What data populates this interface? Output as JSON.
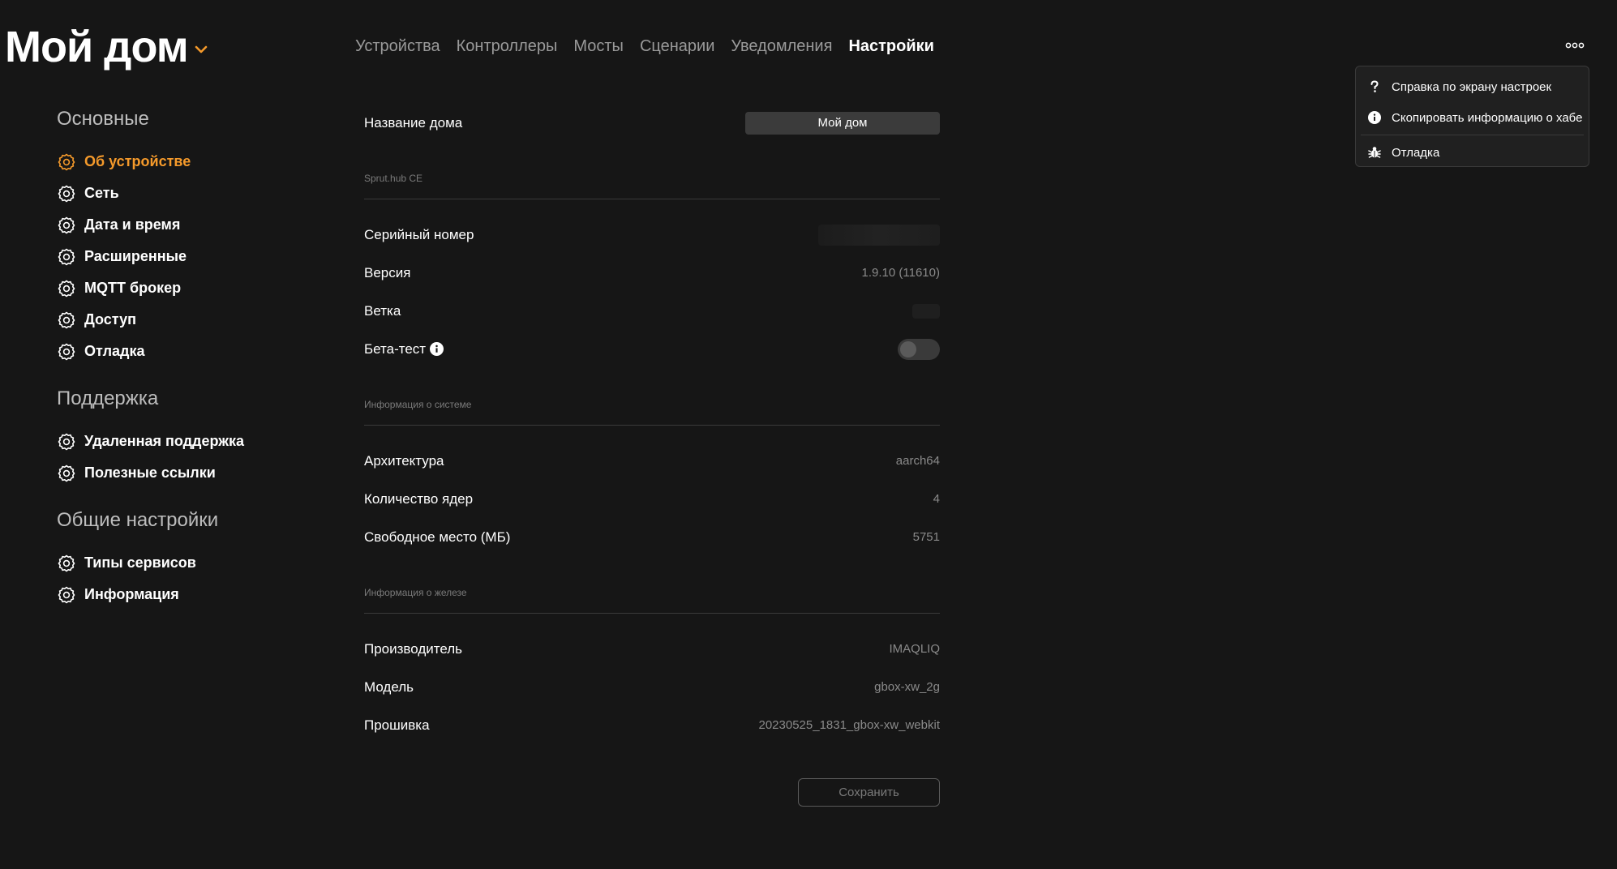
{
  "header": {
    "title": "Мой дом",
    "tabs": [
      {
        "label": "Устройства",
        "active": false
      },
      {
        "label": "Контроллеры",
        "active": false
      },
      {
        "label": "Мосты",
        "active": false
      },
      {
        "label": "Сценарии",
        "active": false
      },
      {
        "label": "Уведомления",
        "active": false
      },
      {
        "label": "Настройки",
        "active": true
      }
    ]
  },
  "menu": {
    "items": [
      {
        "icon": "question-icon",
        "label": "Справка по экрану настроек"
      },
      {
        "icon": "info-icon",
        "label": "Скопировать информацию о хабе"
      },
      {
        "icon": "bug-icon",
        "label": "Отладка"
      }
    ]
  },
  "sidebar": {
    "sections": [
      {
        "title": "Основные",
        "items": [
          {
            "label": "Об устройстве",
            "active": true
          },
          {
            "label": "Сеть"
          },
          {
            "label": "Дата и время"
          },
          {
            "label": "Расширенные"
          },
          {
            "label": "MQTT брокер"
          },
          {
            "label": "Доступ"
          },
          {
            "label": "Отладка"
          }
        ]
      },
      {
        "title": "Поддержка",
        "items": [
          {
            "label": "Удаленная поддержка"
          },
          {
            "label": "Полезные ссылки"
          }
        ]
      },
      {
        "title": "Общие настройки",
        "items": [
          {
            "label": "Типы сервисов"
          },
          {
            "label": "Информация"
          }
        ]
      }
    ]
  },
  "main": {
    "home_name_label": "Название дома",
    "home_name_value": "Мой дом",
    "caption_hub": "Sprut.hub CE",
    "serial_label": "Серийный номер",
    "version_label": "Версия",
    "version_value": "1.9.10 (11610)",
    "branch_label": "Ветка",
    "beta_label": "Бета-тест",
    "beta_enabled": false,
    "caption_system": "Информация о системе",
    "arch_label": "Архитектура",
    "arch_value": "aarch64",
    "cores_label": "Количество ядер",
    "cores_value": "4",
    "free_label": "Свободное место (МБ)",
    "free_value": "5751",
    "caption_hardware": "Информация о железе",
    "vendor_label": "Производитель",
    "vendor_value": "IMAQLIQ",
    "model_label": "Модель",
    "model_value": "gbox-xw_2g",
    "firmware_label": "Прошивка",
    "firmware_value": "20230525_1831_gbox-xw_webkit",
    "save_label": "Сохранить"
  },
  "colors": {
    "background": "#161616",
    "accent": "#f59a2b",
    "muted_text": "#8a8a8a"
  }
}
